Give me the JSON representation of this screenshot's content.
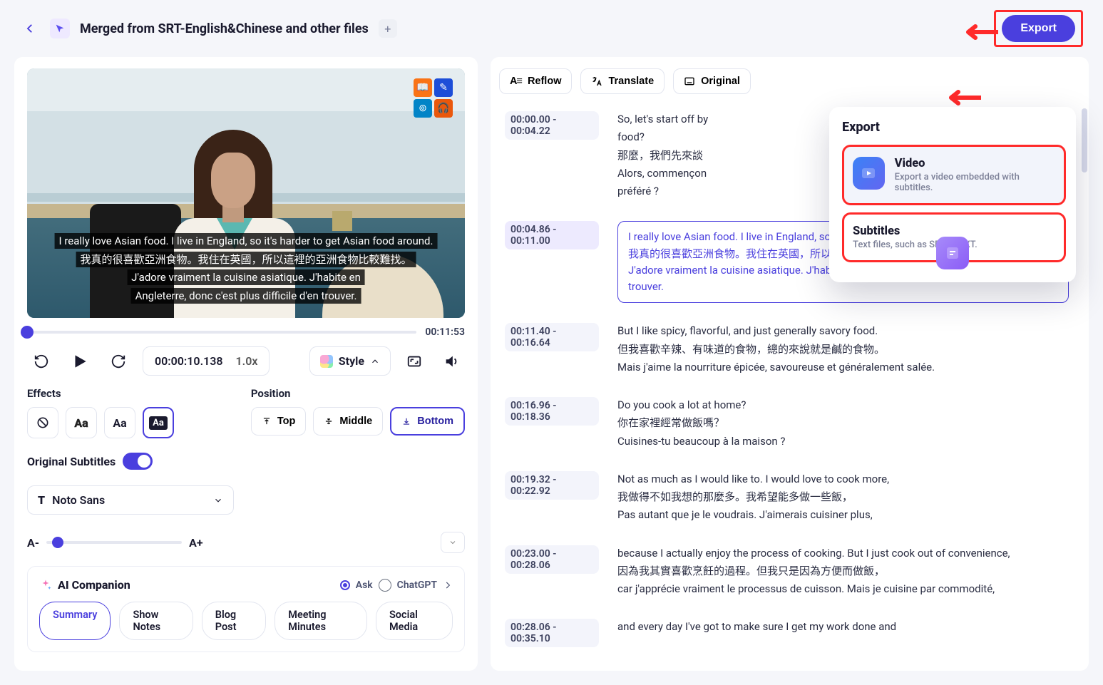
{
  "header": {
    "title": "Merged from SRT-English&Chinese and other files",
    "export_label": "Export"
  },
  "video": {
    "duration_label": "00:11:53",
    "timecode": "00:00:10.138",
    "speed": "1.0x",
    "style_label": "Style",
    "subtitle_en": "I really love Asian food. I live in England, so it's harder to get Asian food around.",
    "subtitle_zh": "我真的很喜歡亞洲食物。我住在英國，所以這裡的亞洲食物比較難找。",
    "subtitle_fr_l1": "J'adore vraiment la cuisine asiatique. J'habite en",
    "subtitle_fr_l2": "Angleterre, donc c'est plus difficile d'en trouver."
  },
  "effects": {
    "title": "Effects",
    "options": [
      "none",
      "Aa-outline",
      "Aa-plain",
      "Aa-box"
    ]
  },
  "position": {
    "title": "Position",
    "top": "Top",
    "middle": "Middle",
    "bottom": "Bottom"
  },
  "original_subtitles_label": "Original Subtitles",
  "font": {
    "name": "Noto Sans",
    "decrease": "A-",
    "increase": "A+"
  },
  "ai": {
    "title": "AI Companion",
    "ask": "Ask",
    "provider": "ChatGPT",
    "chips": [
      "Summary",
      "Show Notes",
      "Blog Post",
      "Meeting Minutes",
      "Social Media"
    ]
  },
  "toolbar": {
    "reflow": "Reflow",
    "translate": "Translate",
    "original": "Original"
  },
  "export_popover": {
    "heading": "Export",
    "video_title": "Video",
    "video_desc": "Export a video embedded with subtitles.",
    "subs_title": "Subtitles",
    "subs_desc": "Text files, such as SRT or TXT."
  },
  "transcript": [
    {
      "ts": "00:00.00 - 00:04.22",
      "lines": [
        "So, let's start off by",
        "food?",
        "那麼，我們先來談",
        "Alors, commençon",
        "préféré ?"
      ],
      "truncated": true
    },
    {
      "ts": "00:04.86 - 00:11.00",
      "active": true,
      "lines": [
        "I really love Asian food. I live in England, so it's harder to get Asian food around.",
        "我真的很喜歡亞洲食物。我住在英國，所以這裡的亞洲食物比較難找。",
        "J'adore vraiment la cuisine asiatique. J'habite en Angleterre, donc c'est plus difficile d'en trouver."
      ]
    },
    {
      "ts": "00:11.40 - 00:16.64",
      "lines": [
        "But I like spicy, flavorful, and just generally savory food.",
        "但我喜歡辛辣、有味道的食物，總的來說就是鹹的食物。",
        "Mais j'aime la nourriture épicée, savoureuse et généralement salée."
      ]
    },
    {
      "ts": "00:16.96 - 00:18.36",
      "lines": [
        "Do you cook a lot at home?",
        "你在家裡經常做飯嗎？",
        "Cuisines-tu beaucoup à la maison ?"
      ]
    },
    {
      "ts": "00:19.32 - 00:22.92",
      "lines": [
        "Not as much as I would like to. I would love to cook more,",
        "我做得不如我想的那麼多。我希望能多做一些飯，",
        "Pas autant que je le voudrais. J'aimerais cuisiner plus,"
      ]
    },
    {
      "ts": "00:23.00 - 00:28.06",
      "lines": [
        "because I actually enjoy the process of cooking. But I just cook out of convenience,",
        "因為我其實喜歡烹飪的過程。但我只是因為方便而做飯，",
        "car j'apprécie vraiment le processus de cuisson. Mais je cuisine par commodité,"
      ]
    },
    {
      "ts": "00:28.06 - 00:35.10",
      "lines": [
        "and every day I've got to make sure I get my work done and"
      ]
    }
  ]
}
